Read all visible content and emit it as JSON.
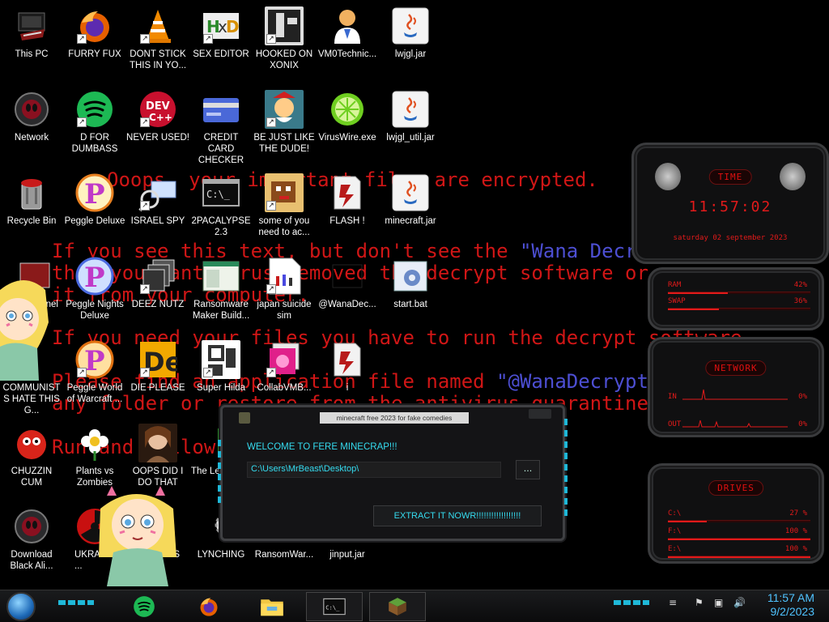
{
  "ransom_lines": {
    "l1": "Ooops, your important files are encrypted.",
    "l2a": "If you see this text, but don't see the ",
    "l2b": "\"Wana Decryptor\"",
    "l3": "then your antivirus removed the decrypt software or",
    "l4": "it from your computer.",
    "l5": "If you need your files you have to run the decrypt software.",
    "l6a": "Please find an application file named ",
    "l6b": "\"@WanaDecryptor@.exe\"",
    "l7": "any folder or restore from the antivirus quarantine.",
    "l8": "Run and follow the instructions!"
  },
  "icons": [
    {
      "label": "This PC",
      "icon": "computer-icon"
    },
    {
      "label": "FURRY FUX",
      "icon": "firefox-icon"
    },
    {
      "label": "DONT STICK THIS IN YO...",
      "icon": "vlc-cone-icon"
    },
    {
      "label": "SEX EDITOR",
      "icon": "hex-editor-icon"
    },
    {
      "label": "HOOKED ON XONIX",
      "icon": "xonix-icon"
    },
    {
      "label": "VM0Technic...",
      "icon": "doctor-icon"
    },
    {
      "label": "lwjgl.jar",
      "icon": "java-icon"
    },
    {
      "label": "Network",
      "icon": "alien-network-icon"
    },
    {
      "label": "D FOR DUMBASS",
      "icon": "spotify-icon"
    },
    {
      "label": "NEVER USED!",
      "icon": "devcpp-icon"
    },
    {
      "label": "CREDIT CARD CHECKER",
      "icon": "credit-card-icon"
    },
    {
      "label": "BE JUST LIKE THE DUDE!",
      "icon": "elf-icon"
    },
    {
      "label": "VirusWire.exe",
      "icon": "lime-icon"
    },
    {
      "label": "lwjgl_util.jar",
      "icon": "java-icon"
    },
    {
      "label": "Recycle Bin",
      "icon": "recycle-bin-icon"
    },
    {
      "label": "Peggle Deluxe",
      "icon": "peggle-icon"
    },
    {
      "label": "ISRAEL SPY",
      "icon": "spy-icon"
    },
    {
      "label": "2PACALYPSE 2.3",
      "icon": "cmd-icon"
    },
    {
      "label": "some of you need to ac...",
      "icon": "pixel-dog-icon"
    },
    {
      "label": "FLASH !",
      "icon": "flash-icon"
    },
    {
      "label": "minecraft.jar",
      "icon": "java-icon"
    },
    {
      "label": "Panel",
      "icon": "control-panel-icon"
    },
    {
      "label": "Peggle Nights Deluxe",
      "icon": "peggle-icon"
    },
    {
      "label": "DEEZ NUTZ",
      "icon": "windows-stack-icon"
    },
    {
      "label": "Ransomware Maker Build...",
      "icon": "window-app-icon"
    },
    {
      "label": "japan suicide sim",
      "icon": "document-icon"
    },
    {
      "label": "@WanaDec...",
      "icon": "wana-icon"
    },
    {
      "label": "start.bat",
      "icon": "batch-gear-icon"
    },
    {
      "label": "COMMUNISTS HATE THIS G...",
      "icon": "star-character-icon"
    },
    {
      "label": "Peggle World of Warcraft ...",
      "icon": "peggle-icon"
    },
    {
      "label": "DIE PLEASE",
      "icon": "de-icon"
    },
    {
      "label": "Super Hilda",
      "icon": "pixel-hilda-icon"
    },
    {
      "label": "CollabVMB...",
      "icon": "collab-icon"
    },
    {
      "label": "i",
      "icon": "flash-icon"
    },
    {
      "label": "CHUZZIN CUM",
      "icon": "chuzzle-icon"
    },
    {
      "label": "Plants vs Zombies",
      "icon": "flower-icon"
    },
    {
      "label": "OOPS DID I DO THAT",
      "icon": "portrait-icon"
    },
    {
      "label": "The Leg... Zi...",
      "icon": "zelda-icon"
    },
    {
      "label": "Download Black Ali...",
      "icon": "alien-icon"
    },
    {
      "label": "UKRA...",
      "icon": "radiation-icon"
    },
    {
      "label": "...S",
      "icon": "hidden-icon"
    },
    {
      "label": "LYNCHING",
      "icon": "gear-icon"
    },
    {
      "label": "RansomWar...",
      "icon": "blank-icon"
    },
    {
      "label": "jinput.jar",
      "icon": "blank-icon"
    }
  ],
  "gadget_time": {
    "title": "TIME",
    "time": "11:57:02",
    "date": "saturday 02 september 2023"
  },
  "gadget_ram": {
    "ram_label": "RAM",
    "ram_value": "42%",
    "swap_label": "SWAP",
    "swap_value": "36%",
    "ram_level": 0.42,
    "swap_level": 0.36
  },
  "gadget_network": {
    "title": "NETWORK",
    "in_label": "IN",
    "in_value": "0%",
    "out_label": "OUT",
    "out_value": "0%"
  },
  "gadget_drives": {
    "title": "DRIVES",
    "drives": [
      {
        "label": "C:\\",
        "value": "27 %",
        "level": 0.27
      },
      {
        "label": "F:\\",
        "value": "100 %",
        "level": 1.0
      },
      {
        "label": "E:\\",
        "value": "100 %",
        "level": 1.0
      }
    ]
  },
  "dialog": {
    "title": "minecraft free 2023 for fake comedies",
    "welcome": "WELCOME TO FERE MINECRAP!!!",
    "path": "C:\\Users\\MrBeast\\Desktop\\",
    "browse_label": "...",
    "extract_label": "EXTRACT IT NOWR!!!!!!!!!!!!!!!!!!"
  },
  "taskbar": {
    "time": "11:57 AM",
    "date": "9/2/2023"
  },
  "colors": {
    "ransom_red": "#d01616",
    "ransom_blue": "#4d4fd3",
    "accent_cyan": "#35dcf0",
    "gadget_red": "#e21a1a"
  }
}
